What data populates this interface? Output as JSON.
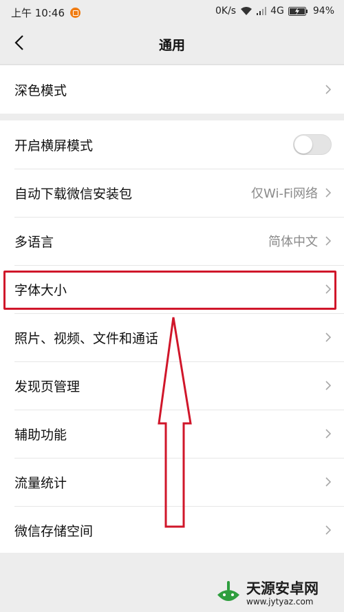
{
  "status_bar": {
    "time": "上午 10:46",
    "speed": "0K/s",
    "network": "4G",
    "battery": "94%"
  },
  "nav": {
    "title": "通用"
  },
  "group1": {
    "items": [
      {
        "label": "深色模式",
        "value": ""
      }
    ]
  },
  "group2": {
    "items": [
      {
        "label": "开启横屏模式",
        "value": "",
        "toggle_on": false
      },
      {
        "label": "自动下载微信安装包",
        "value": "仅Wi-Fi网络"
      },
      {
        "label": "多语言",
        "value": "简体中文"
      },
      {
        "label": "字体大小",
        "value": ""
      },
      {
        "label": "照片、视频、文件和通话",
        "value": ""
      },
      {
        "label": "发现页管理",
        "value": ""
      },
      {
        "label": "辅助功能",
        "value": ""
      },
      {
        "label": "流量统计",
        "value": ""
      },
      {
        "label": "微信存储空间",
        "value": ""
      }
    ]
  },
  "watermark": {
    "title": "天源安卓网",
    "url": "www.jytyaz.com"
  },
  "colors": {
    "background": "#ededed",
    "annotation_red": "#d0162a",
    "watermark_green": "#2e9e3e"
  }
}
